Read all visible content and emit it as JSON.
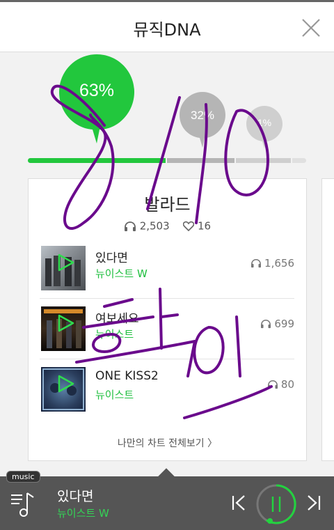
{
  "header": {
    "title": "뮤직DNA"
  },
  "dna": {
    "percents": [
      "63%",
      "32%",
      "1%"
    ],
    "primary_color": "#22c73d",
    "secondary_color": "#b5b5b5"
  },
  "card": {
    "genre": "발라드",
    "listens": "2,503",
    "likes": "16",
    "songs": [
      {
        "title": "있다면",
        "artist": "뉴이스트 W",
        "plays": "1,656"
      },
      {
        "title": "여보세요",
        "artist": "뉴이스트",
        "plays": "699"
      },
      {
        "title": "ONE KISS2",
        "artist": "뉴이스트",
        "plays": "80"
      }
    ],
    "more_label": "나만의 차트 전체보기 〉"
  },
  "player": {
    "tag": "music",
    "title": "있다면",
    "artist": "뉴이스트 W"
  },
  "annotation": {
    "text_1": "8/10",
    "text_2": "확인",
    "color": "#6a0a8c"
  }
}
